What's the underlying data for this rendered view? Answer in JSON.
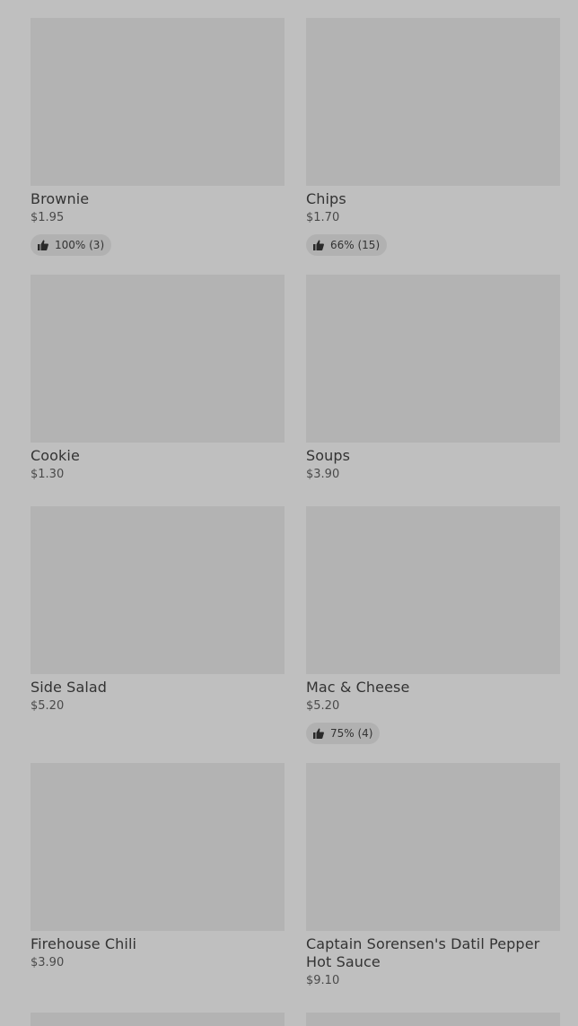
{
  "items": [
    {
      "name": "Brownie",
      "price": "$1.95",
      "rating": "100% (3)"
    },
    {
      "name": "Chips",
      "price": "$1.70",
      "rating": "66% (15)"
    },
    {
      "name": "Cookie",
      "price": "$1.30",
      "rating": ""
    },
    {
      "name": "Soups",
      "price": "$3.90",
      "rating": ""
    },
    {
      "name": "Side Salad",
      "price": "$5.20",
      "rating": ""
    },
    {
      "name": "Mac & Cheese",
      "price": "$5.20",
      "rating": "75% (4)"
    },
    {
      "name": "Firehouse Chili",
      "price": "$3.90",
      "rating": ""
    },
    {
      "name": "Captain Sorensen's Datil Pepper Hot Sauce",
      "price": "$9.10",
      "rating": ""
    }
  ],
  "colors": {
    "background": "#bfbfbf",
    "image_placeholder": "#b3b3b3",
    "rating_badge": "#b1b1b1",
    "text": "#333333"
  },
  "icons": {
    "rating": "thumbs-up-icon"
  }
}
